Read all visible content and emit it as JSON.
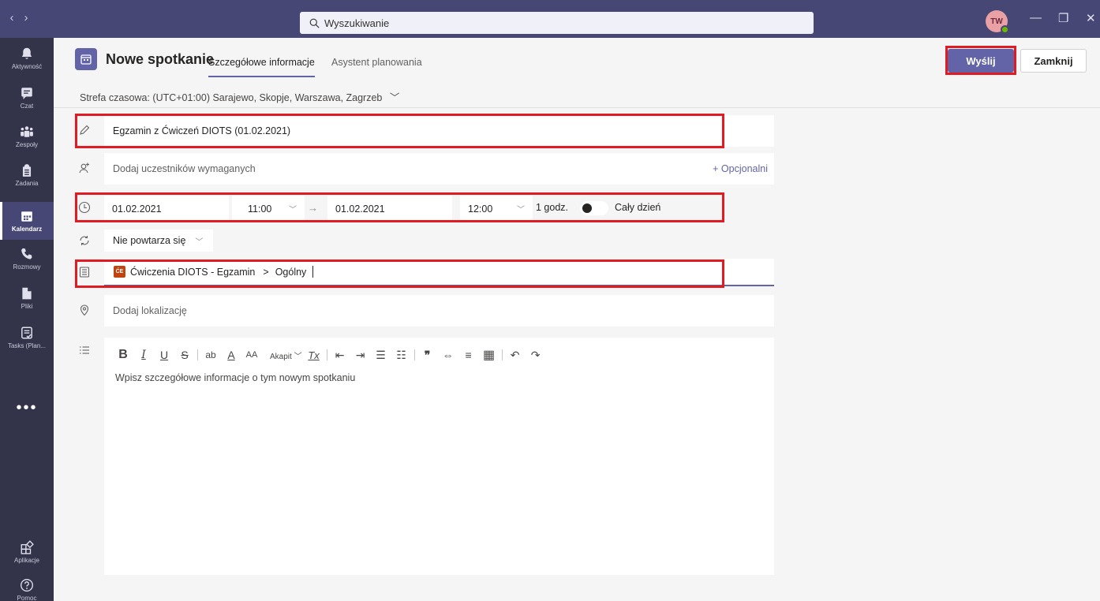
{
  "titlebar": {
    "back": "‹",
    "forward": "›",
    "search_placeholder": "Wyszukiwanie",
    "avatar_initials": "TW",
    "status_color": "#6bb700"
  },
  "rail": {
    "items": [
      {
        "label": "Aktywność",
        "icon": "bell-icon"
      },
      {
        "label": "Czat",
        "icon": "chat-icon"
      },
      {
        "label": "Zespoły",
        "icon": "teams-icon"
      },
      {
        "label": "Zadania",
        "icon": "tasks-icon"
      },
      {
        "label": "Kalendarz",
        "icon": "calendar-icon"
      },
      {
        "label": "Rozmowy",
        "icon": "phone-icon"
      },
      {
        "label": "Pliki",
        "icon": "file-icon"
      },
      {
        "label": "Tasks (Plan...",
        "icon": "planner-icon"
      }
    ],
    "more": "•••",
    "apps": "Aplikacje",
    "help": "Pomoc"
  },
  "header": {
    "title": "Nowe spotkanie",
    "tabs": [
      "Szczegółowe informacje",
      "Asystent planowania"
    ],
    "send": "Wyślij",
    "close": "Zamknij"
  },
  "timezone": "Strefa czasowa: (UTC+01:00) Sarajewo, Skopje, Warszawa, Zagrzeb",
  "form": {
    "title": "Egzamin z Ćwiczeń DIOTS (01.02.2021)",
    "attendees_placeholder": "Dodaj uczestników wymaganych",
    "optional": "+ Opcjonalni",
    "start_date": "01.02.2021",
    "start_time": "11:00",
    "end_date": "01.02.2021",
    "end_time": "12:00",
    "duration": "1 godz.",
    "all_day": "Cały dzień",
    "repeat": "Nie powtarza się",
    "team_badge": "ĆE",
    "team": "Ćwiczenia DIOTS - Egzamin",
    "channel_sep": ">",
    "channel": "Ogólny",
    "location_placeholder": "Dodaj lokalizację",
    "details_placeholder": "Wpisz szczegółowe informacje o tym nowym spotkaniu"
  },
  "toolbar": {
    "bold": "B",
    "italic": "I",
    "underline": "U",
    "strike": "S",
    "highlight": "ab",
    "font_color": "A",
    "font_size": "AA",
    "paragraph": "Akapit",
    "clear": "Tx",
    "outdent": "⇤",
    "indent": "⇥",
    "bullets": "☰",
    "numbered": "☷",
    "quote": "❞",
    "link": "⇔",
    "hr": "≡",
    "table": "▦",
    "undo": "↶",
    "redo": "↷"
  },
  "colors": {
    "titlebar": "#464775",
    "rail": "#33344a",
    "accent": "#6264a7",
    "highlight_box": "#e01b24"
  }
}
